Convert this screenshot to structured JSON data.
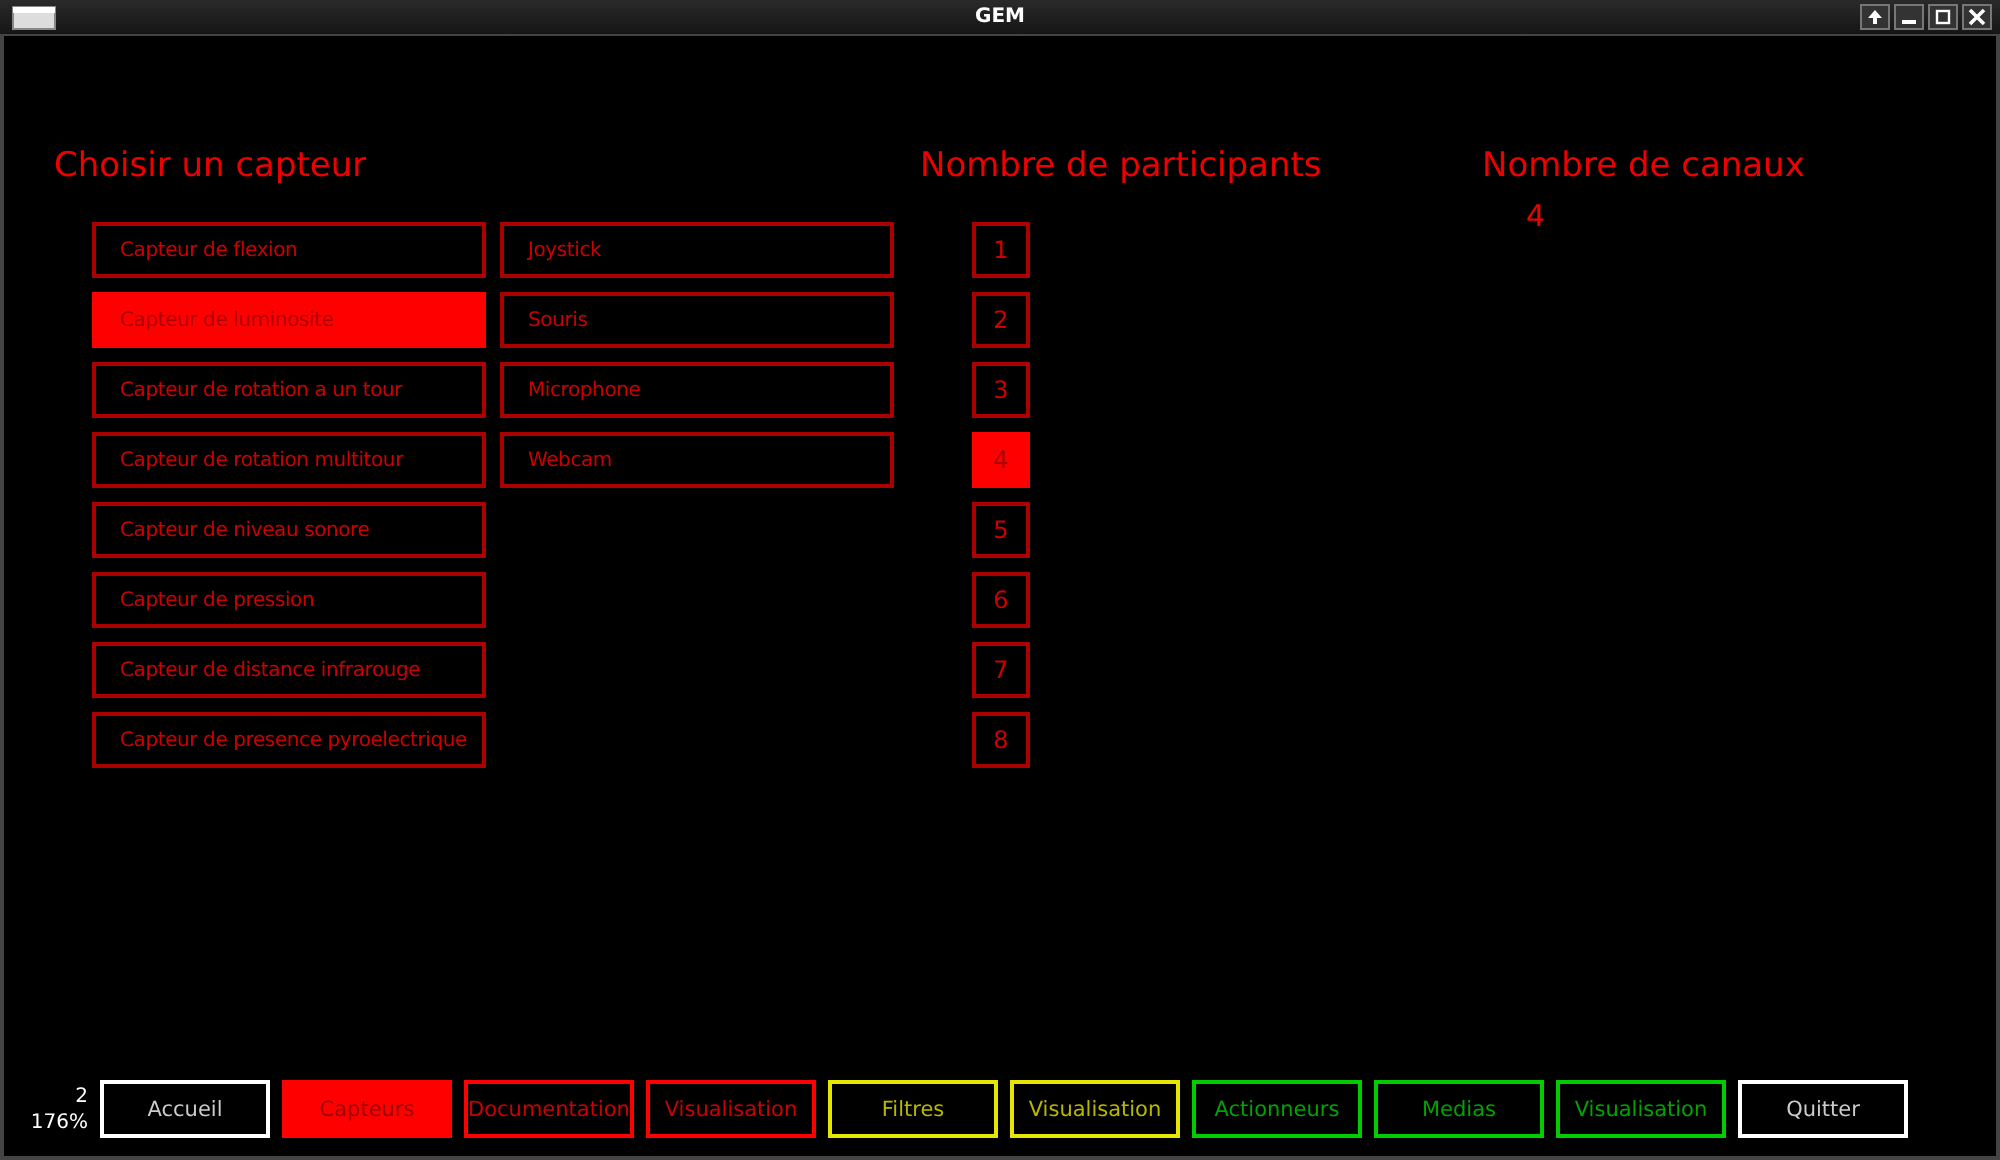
{
  "window": {
    "title": "GEM"
  },
  "sensor_section": {
    "heading": "Choisir un capteur",
    "columns": [
      [
        {
          "label": "Capteur de flexion",
          "selected": false
        },
        {
          "label": "Capteur de luminosite",
          "selected": true
        },
        {
          "label": "Capteur de rotation a un tour",
          "selected": false
        },
        {
          "label": "Capteur de rotation multitour",
          "selected": false
        },
        {
          "label": "Capteur de niveau sonore",
          "selected": false
        },
        {
          "label": "Capteur de pression",
          "selected": false
        },
        {
          "label": "Capteur de distance infrarouge",
          "selected": false
        },
        {
          "label": "Capteur de presence pyroelectrique",
          "selected": false
        }
      ],
      [
        {
          "label": "Joystick",
          "selected": false
        },
        {
          "label": "Souris",
          "selected": false
        },
        {
          "label": "Microphone",
          "selected": false
        },
        {
          "label": "Webcam",
          "selected": false
        }
      ]
    ]
  },
  "participants_section": {
    "heading": "Nombre de participants",
    "options": [
      {
        "label": "1",
        "selected": false
      },
      {
        "label": "2",
        "selected": false
      },
      {
        "label": "3",
        "selected": false
      },
      {
        "label": "4",
        "selected": true
      },
      {
        "label": "5",
        "selected": false
      },
      {
        "label": "6",
        "selected": false
      },
      {
        "label": "7",
        "selected": false
      },
      {
        "label": "8",
        "selected": false
      }
    ]
  },
  "channels_section": {
    "heading": "Nombre de canaux",
    "value": "4"
  },
  "status": {
    "page": "2",
    "zoom": "176%"
  },
  "nav_buttons": [
    {
      "label": "Accueil",
      "color": "#ffffff",
      "selected": false
    },
    {
      "label": "Capteurs",
      "color": "#ff0000",
      "selected": true
    },
    {
      "label": "Documentation",
      "color": "#ff0000",
      "selected": false
    },
    {
      "label": "Visualisation",
      "color": "#ff0000",
      "selected": false
    },
    {
      "label": "Filtres",
      "color": "#e6e600",
      "selected": false
    },
    {
      "label": "Visualisation",
      "color": "#e6e600",
      "selected": false
    },
    {
      "label": "Actionneurs",
      "color": "#00cc00",
      "selected": false
    },
    {
      "label": "Medias",
      "color": "#00cc00",
      "selected": false
    },
    {
      "label": "Visualisation",
      "color": "#00cc00",
      "selected": false
    },
    {
      "label": "Quitter",
      "color": "#ffffff",
      "selected": false
    }
  ]
}
